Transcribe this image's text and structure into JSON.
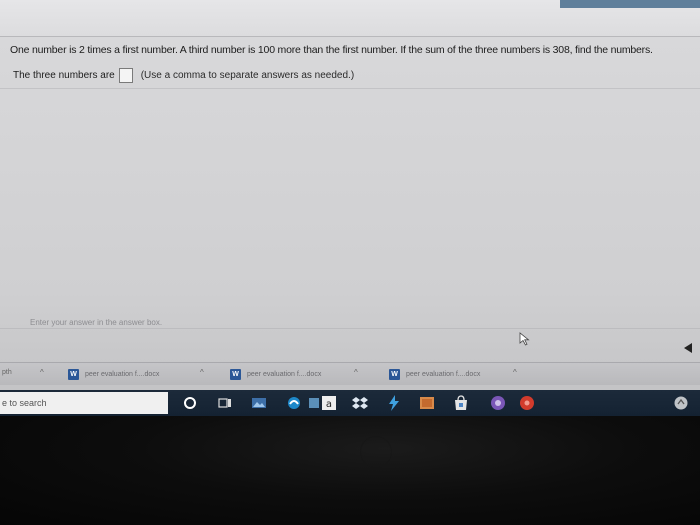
{
  "question": {
    "text": "One number is 2 times a first number. A third number is 100 more than the first number. If the sum of the three numbers is 308, find the numbers."
  },
  "answer": {
    "label": "The three numbers are",
    "value": "",
    "hint": "(Use a comma to separate answers as needed.)"
  },
  "status_text": "Enter your answer in the answer box.",
  "downloads": {
    "stub": "pth",
    "items": [
      {
        "name": "peer evaluation f....docx"
      },
      {
        "name": "peer evaluation f....docx"
      },
      {
        "name": "peer evaluation f....docx"
      }
    ]
  },
  "taskbar": {
    "search_text": "e to search"
  },
  "colors": {
    "word_blue": "#2b5797",
    "taskbar_bg": "#1c2a3a"
  }
}
